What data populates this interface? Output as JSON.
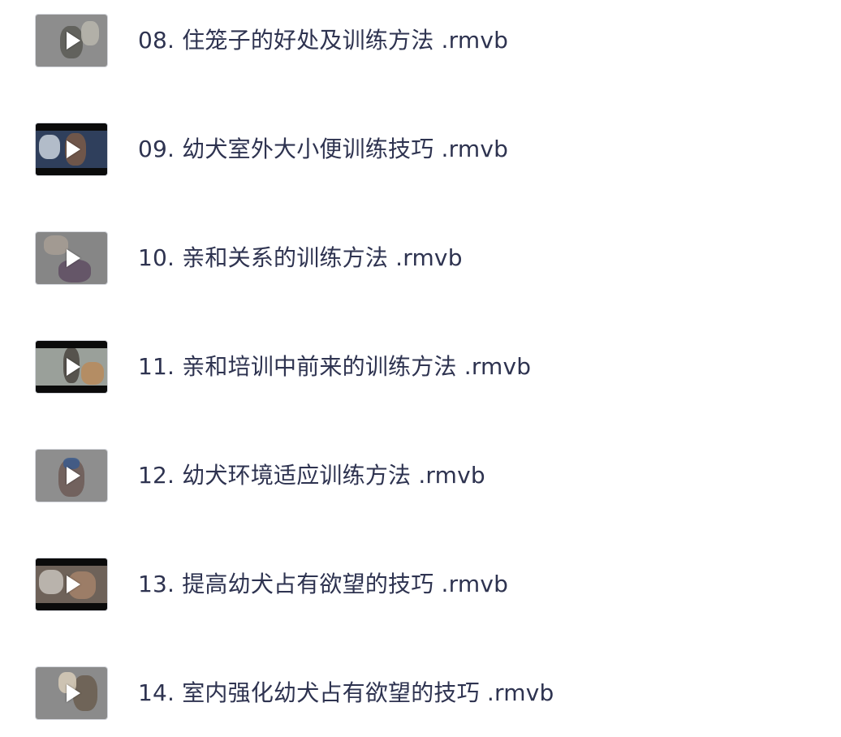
{
  "files": [
    {
      "title": "08. 住笼子的好处及训练方法 .rmvb",
      "thumb": {
        "bg": "#8d8d8d",
        "figure": "#5b5a55",
        "accent": "#b9b6ad",
        "letterbox": false
      }
    },
    {
      "title": "09. 幼犬室外大小便训练技巧 .rmvb",
      "thumb": {
        "bg": "#2f3f5c",
        "figure": "#7a5b46",
        "accent": "#c9d2dc",
        "letterbox": true
      }
    },
    {
      "title": "10. 亲和关系的训练方法 .rmvb",
      "thumb": {
        "bg": "#868686",
        "figure": "#5f4e63",
        "accent": "#a79d94",
        "letterbox": false
      }
    },
    {
      "title": "11. 亲和培训中前来的训练方法 .rmvb",
      "thumb": {
        "bg": "#9aa09a",
        "figure": "#4a4540",
        "accent": "#b98a5a",
        "letterbox": true
      }
    },
    {
      "title": "12. 幼犬环境适应训练方法 .rmvb",
      "thumb": {
        "bg": "#8e8e8e",
        "figure": "#6d5a56",
        "accent": "#3b5a8c",
        "letterbox": false
      }
    },
    {
      "title": "13. 提高幼犬占有欲望的技巧 .rmvb",
      "thumb": {
        "bg": "#6e6259",
        "figure": "#a5826a",
        "accent": "#c7c2bb",
        "letterbox": true
      }
    },
    {
      "title": "14. 室内强化幼犬占有欲望的技巧 .rmvb",
      "thumb": {
        "bg": "#8b8b8b",
        "figure": "#6a5d4f",
        "accent": "#d8cdb8",
        "letterbox": false
      }
    }
  ],
  "icons": {
    "thumbnail_overlay": "play-icon"
  }
}
